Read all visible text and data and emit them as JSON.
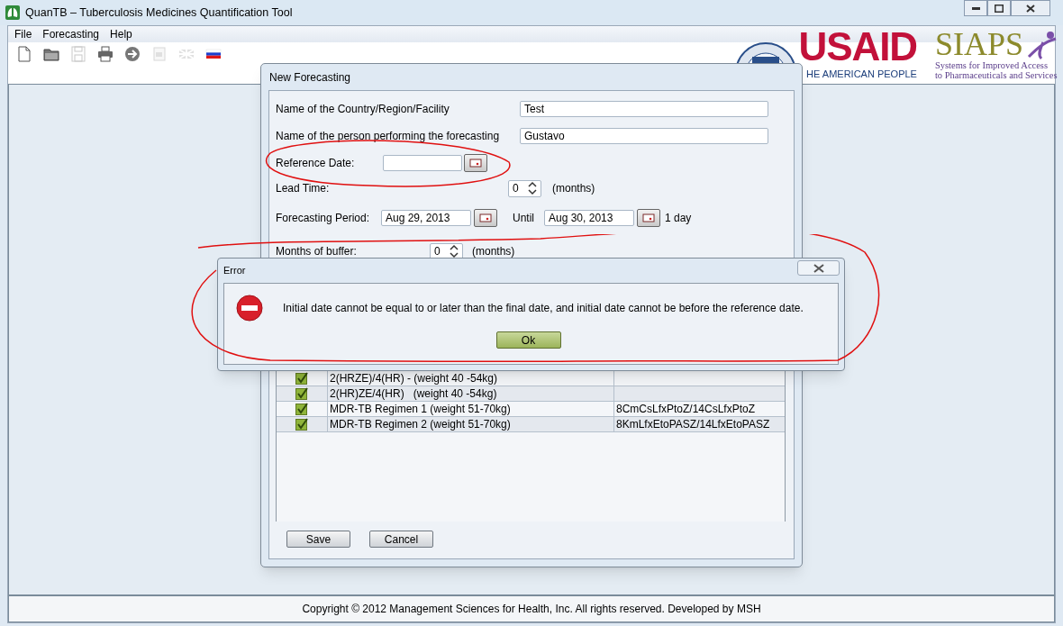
{
  "window": {
    "title": "QuanTB – Tuberculosis Medicines Quantification Tool"
  },
  "menu": [
    "File",
    "Forecasting",
    "Help"
  ],
  "toolbar": [
    {
      "kind": "new",
      "disabled": false
    },
    {
      "kind": "open",
      "disabled": false
    },
    {
      "kind": "save",
      "disabled": true
    },
    {
      "kind": "print",
      "disabled": false
    },
    {
      "kind": "go",
      "disabled": false
    },
    {
      "kind": "export",
      "disabled": true
    },
    {
      "kind": "flag-uk",
      "disabled": true
    },
    {
      "kind": "flag-ru",
      "disabled": false
    }
  ],
  "logos": {
    "usaid": "USAID",
    "usaid_tagline": "HE AMERICAN PEOPLE",
    "siaps": "SIAPS",
    "siaps_tagline": [
      "Systems for Improved Access",
      "to Pharmaceuticals and Services"
    ]
  },
  "forecast_dialog": {
    "title": "New Forecasting",
    "country": {
      "label": "Name of the Country/Region/Facility",
      "value": "Test"
    },
    "person": {
      "label": "Name of the person performing the forecasting",
      "value": "Gustavo"
    },
    "reference_date": {
      "label": "Reference Date:"
    },
    "lead_time": {
      "label": "Lead Time:",
      "value": "0",
      "unit": "(months)"
    },
    "period": {
      "label": "Forecasting Period:",
      "from": "Aug 29, 2013",
      "until_label": "Until",
      "until": "Aug 30, 2013",
      "duration": "1 day"
    },
    "buffer": {
      "label": "Months of buffer:",
      "value": "0",
      "unit": "(months)"
    },
    "regimens": [
      {
        "checked": true,
        "name": "2(HRZE)/4(HR) - (weight 40 -54kg)"
      },
      {
        "checked": true,
        "name": "2(HR)ZE/4(HR)   (weight 40 -54kg)"
      },
      {
        "checked": true,
        "name": "MDR-TB Regimen 1 (weight 51-70kg)",
        "code": "8CmCsLfxPtoZ/14CsLfxPtoZ"
      },
      {
        "checked": true,
        "name": "MDR-TB Regimen 2 (weight 51-70kg)",
        "code": "8KmLfxEtoPASZ/14LfxEtoPASZ"
      }
    ],
    "buttons": [
      "Save",
      "Cancel"
    ]
  },
  "error_dialog": {
    "title": "Error",
    "message": "Initial date cannot be equal to or later than the final date, and initial date cannot be before the reference date.",
    "button": "Ok"
  },
  "footer": "Copyright © 2012 Management Sciences for Health, Inc. All rights reserved. Developed by MSH"
}
